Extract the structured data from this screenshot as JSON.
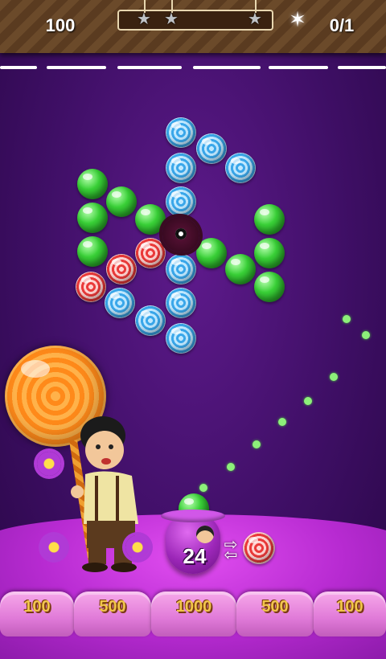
{
  "hud": {
    "score": "100",
    "objective": "0/1",
    "progress_fraction": 0.0,
    "stars": [
      {
        "name": "star-1",
        "icon": "star-icon",
        "filled": false
      },
      {
        "name": "star-2",
        "icon": "star-icon",
        "filled": false
      },
      {
        "name": "star-3",
        "icon": "star-icon",
        "filled": false
      }
    ],
    "objective_icon": "sparkle-icon"
  },
  "board": {
    "colors": {
      "blue": "#3aa7ea",
      "green": "#39d137",
      "red": "#ea3a3a"
    },
    "blocker_icon": "dark-blob-icon"
  },
  "shooter": {
    "shots_left": "24",
    "current_ball": "green",
    "next_ball": "red"
  },
  "buckets": [
    {
      "label": "100"
    },
    {
      "label": "500"
    },
    {
      "label": "1000"
    },
    {
      "label": "500"
    },
    {
      "label": "100"
    }
  ]
}
